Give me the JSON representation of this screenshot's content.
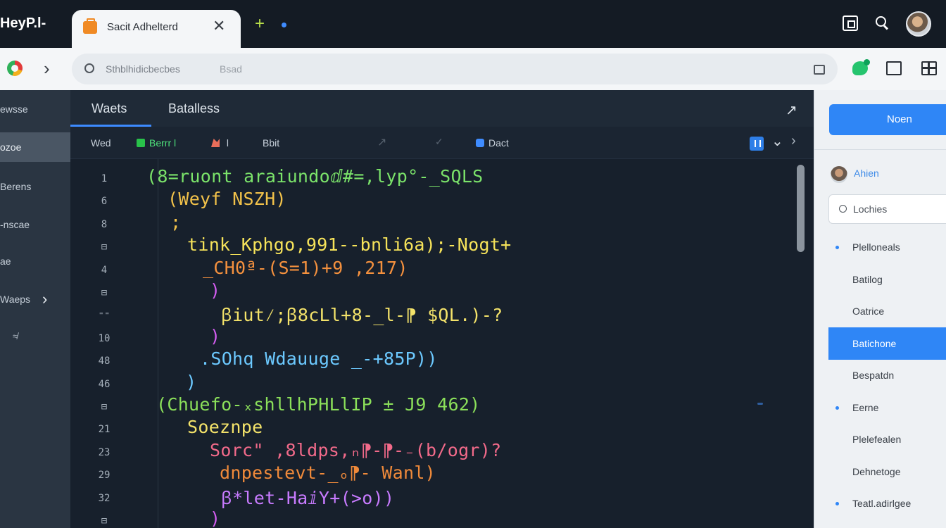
{
  "window": {
    "app_title": "HeyP.l-",
    "tab_label": "Sacit Adhelterd",
    "close_glyph": "✕",
    "newtab_glyph": "+"
  },
  "address_bar": {
    "url_text": "Sthblhidicbecbes",
    "extra_text": "Bsad"
  },
  "left_sidebar": {
    "items": [
      {
        "label": "ewsse"
      },
      {
        "label": "ozoe"
      },
      {
        "label": "Berens"
      },
      {
        "label": "-nscae"
      },
      {
        "label": "ae"
      },
      {
        "label": "Waeps"
      }
    ],
    "mini_icon": "≉"
  },
  "editor": {
    "tabs": [
      {
        "label": "Waets"
      },
      {
        "label": "Batalless"
      }
    ],
    "expand_glyph": "↗",
    "toolbar": {
      "wed_label": "Wed",
      "run_label": "Berrr l",
      "stop_label": "l",
      "edit_label": "Bbit",
      "db_label": "Dact",
      "ghost_arrow": "↗",
      "ghost_check": "✓",
      "down_glyph": "⌄",
      "more_glyph": "›"
    },
    "line_numbers": [
      "1",
      "6",
      "8",
      "⊟",
      "4",
      "⊟",
      "⁼⁼",
      "10",
      "48",
      "46",
      "⊟",
      "21",
      "23",
      "29",
      "32",
      "⊟"
    ],
    "code_lines": [
      {
        "text": "(8=ruont araiundoⅆ#=,lyp°-_SQLS",
        "color": "#7be36a"
      },
      {
        "text": "(Weyf NSZH)",
        "color": "#f2c24a"
      },
      {
        "text": ";",
        "color": "#f2c24a"
      },
      {
        "text": "tink_Kphgo,991--bnli6a);-Nogt+",
        "color": "#f6e35a"
      },
      {
        "text": "_CH0ª-(S=1)+9 ,217)",
        "color": "#f5913e"
      },
      {
        "text": ")",
        "color": "#d35df0"
      },
      {
        "text": "ꞵiut⁄;ꞵ8cLl+8-_l-⁋ $QL.)-?",
        "color": "#f4e36a"
      },
      {
        "text": ")",
        "color": "#d35df0"
      },
      {
        "text": ".SOhq Wdauuge _-+85P))",
        "color": "#6cc9ff"
      },
      {
        "text": ")",
        "color": "#6cc9ff"
      },
      {
        "text": "(Chuefo-ₓshllhPHLlIP ± J9 462)",
        "color": "#8be05a"
      },
      {
        "text": "Soeznpe",
        "color": "#f4e36a"
      },
      {
        "text": "Sorc\" ,8ldps,ₙ⁋-⁋-₋(b/ogr)?",
        "color": "#f26a8a"
      },
      {
        "text": "dnpestevt-_ₒ⁋- Wanl)",
        "color": "#f08a3a"
      },
      {
        "text": "ꞵ*let-HaⅈY+(>o))",
        "color": "#c87bff"
      },
      {
        "text": ")",
        "color": "#d35df0"
      }
    ]
  },
  "right_panel": {
    "primary_button": "Noen",
    "user_label": "Ahien",
    "search_placeholder": "Lochies",
    "items": [
      {
        "label": "Plelloneals",
        "bullet": true,
        "active": false
      },
      {
        "label": "Batilog",
        "bullet": false,
        "active": false
      },
      {
        "label": "Oatrice",
        "bullet": false,
        "active": false
      },
      {
        "label": "Batichone",
        "bullet": false,
        "active": true
      },
      {
        "label": "Bespatdn",
        "bullet": false,
        "active": false
      },
      {
        "label": "Eerne",
        "bullet": true,
        "active": false
      },
      {
        "label": "Plelefealen",
        "bullet": false,
        "active": false
      },
      {
        "label": "Dehnetoge",
        "bullet": false,
        "active": false
      },
      {
        "label": "Teatl.adirlgee",
        "bullet": true,
        "active": false
      }
    ]
  },
  "colors": {
    "accent": "#2f86f6",
    "editor_bg": "#17202c",
    "titlebar_bg": "#141b24"
  }
}
